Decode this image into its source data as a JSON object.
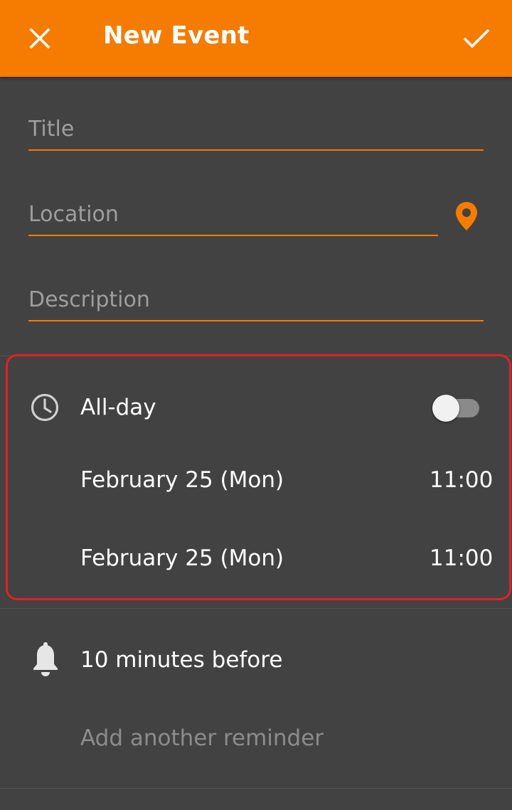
{
  "appbar": {
    "title": "New Event",
    "close_icon": "close-icon",
    "done_icon": "check-icon",
    "color": "#f57c00"
  },
  "form": {
    "title_placeholder": "Title",
    "title_value": "",
    "location_placeholder": "Location",
    "location_value": "",
    "description_placeholder": "Description",
    "description_value": "",
    "location_icon": "location-pin-icon"
  },
  "time": {
    "all_day_label": "All-day",
    "all_day_on": false,
    "start_date": "February 25 (Mon)",
    "start_time": "11:00",
    "end_date": "February 25 (Mon)",
    "end_time": "11:00"
  },
  "reminders": {
    "first": "10 minutes before",
    "add_another": "Add another reminder"
  },
  "colors": {
    "background": "#424242",
    "accent": "#f57c00",
    "highlight_border": "#e0202a"
  }
}
